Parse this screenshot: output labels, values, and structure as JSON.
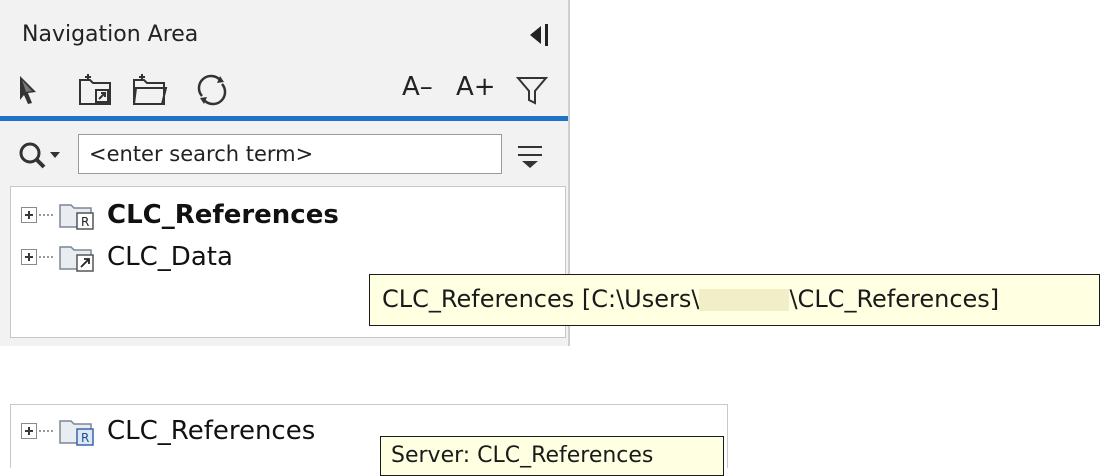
{
  "panel": {
    "title": "Navigation Area",
    "font_smaller": "A–",
    "font_larger": "A+",
    "search": {
      "placeholder": "<enter search term>",
      "value": "<enter search term>"
    },
    "tree": [
      {
        "label": "CLC_References",
        "bold": true,
        "icon": "folder-r-icon"
      },
      {
        "label": "CLC_Data",
        "bold": false,
        "icon": "folder-link-icon"
      }
    ],
    "tooltip": {
      "prefix": "CLC_References [C:\\Users\\",
      "suffix": "\\CLC_References]"
    }
  },
  "bottom": {
    "tree_item": {
      "label": "CLC_References",
      "icon": "folder-r-icon"
    },
    "tooltip": "Server: CLC_References"
  },
  "colors": {
    "accent_line": "#1e73c8",
    "tooltip_bg": "#ffffe1",
    "panel_bg": "#f2f2f2"
  }
}
